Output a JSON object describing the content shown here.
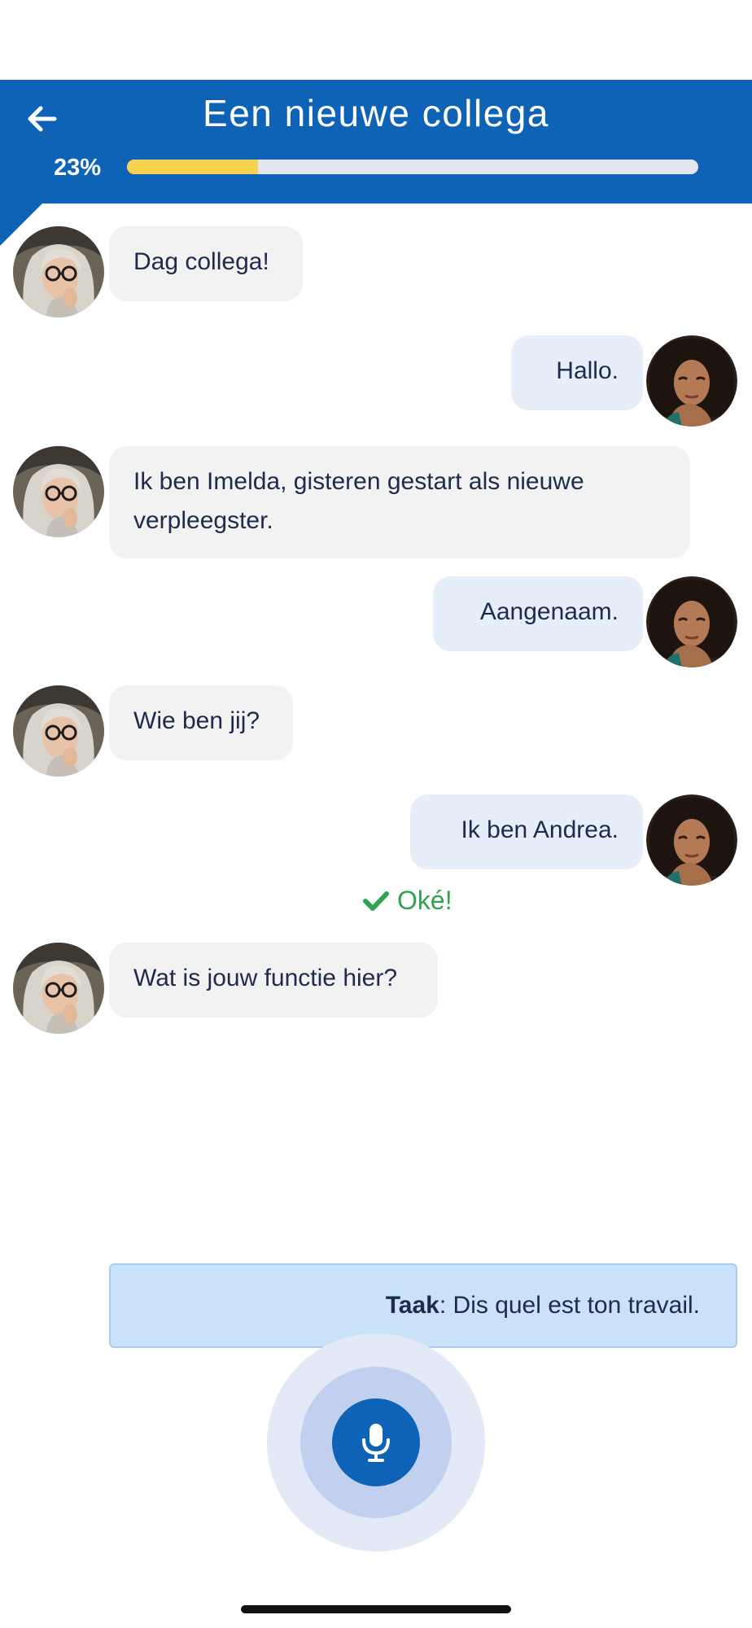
{
  "header": {
    "title": "Een nieuwe collega",
    "progress_label": "23%",
    "progress_fraction": 0.23,
    "back_icon": "arrow-left-icon"
  },
  "colors": {
    "header_bg": "#0f63b6",
    "progress_fill": "#f7d24f",
    "progress_track": "#e3e6ec",
    "bubble_incoming": "#f2f2f2",
    "bubble_outgoing": "#e6eef9",
    "success": "#2ea44f",
    "task_bg": "#c9e1f9",
    "mic_button": "#0f63b6"
  },
  "messages": [
    {
      "speaker": "Imelda",
      "side": "incoming",
      "text": "Dag collega!"
    },
    {
      "speaker": "Andrea",
      "side": "outgoing",
      "text": "Hallo."
    },
    {
      "speaker": "Imelda",
      "side": "incoming",
      "text": "Ik ben Imelda, gisteren gestart als nieuwe verpleegster."
    },
    {
      "speaker": "Andrea",
      "side": "outgoing",
      "text": "Aangenaam."
    },
    {
      "speaker": "Imelda",
      "side": "incoming",
      "text": "Wie ben jij?"
    },
    {
      "speaker": "Andrea",
      "side": "outgoing",
      "text": "Ik ben Andrea."
    },
    {
      "speaker": "Imelda",
      "side": "incoming",
      "text": "Wat is jouw functie hier?"
    }
  ],
  "feedback": {
    "text": "Oké!",
    "icon": "checkmark-icon"
  },
  "task": {
    "label": "Taak",
    "separator": ":",
    "text": " Dis quel est ton travail."
  },
  "mic": {
    "icon": "microphone-icon"
  }
}
